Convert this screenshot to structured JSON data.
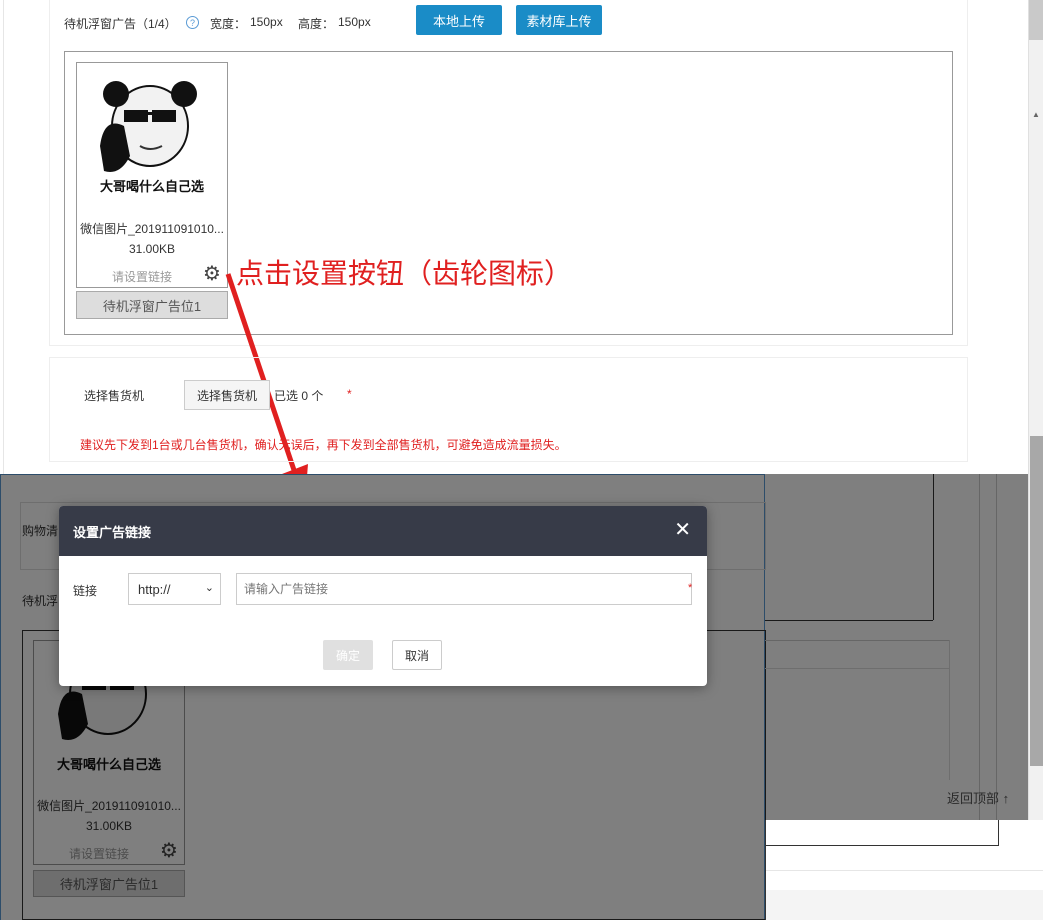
{
  "ad_section": {
    "title": "待机浮窗广告（1/4）",
    "width_label": "宽度：",
    "width_value": "150px",
    "height_label": "高度：",
    "height_value": "150px",
    "upload_local": "本地上传",
    "upload_library": "素材库上传"
  },
  "ad_item": {
    "image_caption": "大哥喝什么自己选",
    "file_name": "微信图片_201911091010...",
    "file_size": "31.00KB",
    "link_hint": "请设置链接",
    "position_label": "待机浮窗广告位1"
  },
  "annotation": {
    "text": "点击设置按钮（齿轮图标）",
    "color": "#e02020"
  },
  "machine_section": {
    "label": "选择售货机",
    "button": "选择售货机",
    "selected_text": "已选 0 个",
    "required_mark": "*",
    "warning": "建议先下发到1台或几台售货机，确认无误后，再下发到全部售货机，可避免造成流量损失。"
  },
  "background_window": {
    "row1_label": "购物清",
    "row2_label": "待机浮",
    "back_to_top": "返回顶部"
  },
  "modal": {
    "title": "设置广告链接",
    "link_label": "链接",
    "protocol_selected": "http://",
    "url_placeholder": "请输入广告链接",
    "required_mark": "*",
    "confirm": "确定",
    "cancel": "取消"
  }
}
